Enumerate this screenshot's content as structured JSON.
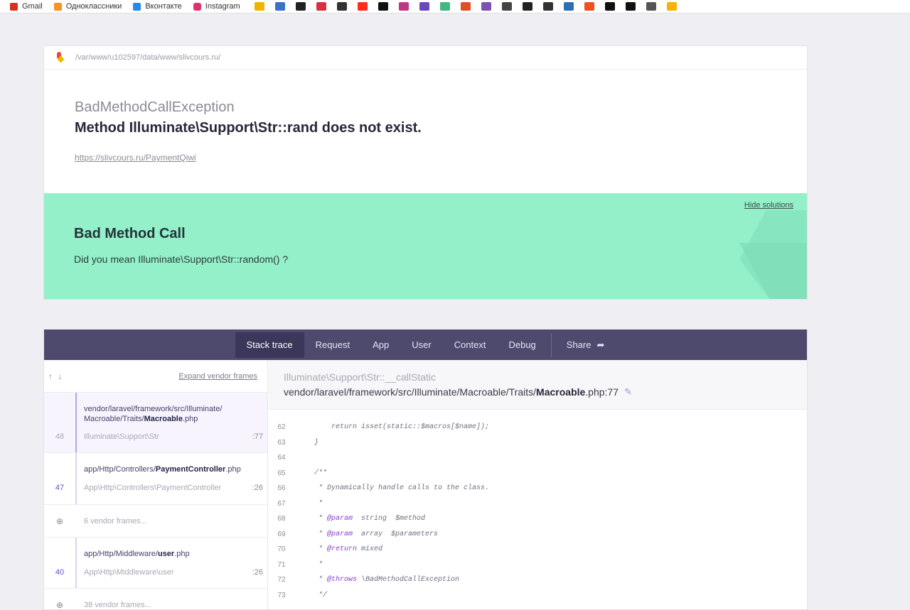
{
  "bookmarks": {
    "items": [
      {
        "label": "Gmail",
        "color": "#d93025"
      },
      {
        "label": "Одноклассники",
        "color": "#f7931e"
      },
      {
        "label": "Вконтакте",
        "color": "#2787f5"
      },
      {
        "label": "Instagram",
        "color": "#e1306c"
      }
    ],
    "icons": [
      {
        "name": "bookmark-pen-icon",
        "color": "#f0b400"
      },
      {
        "name": "bookmark-mdb-icon",
        "color": "#3b71ca"
      },
      {
        "name": "bookmark-doc-icon",
        "color": "#222222"
      },
      {
        "name": "bookmark-pdf-icon",
        "color": "#d9303e"
      },
      {
        "name": "bookmark-box-icon",
        "color": "#333333"
      },
      {
        "name": "bookmark-laravel-icon",
        "color": "#ff2d20"
      },
      {
        "name": "bookmark-dev-icon",
        "color": "#111111"
      },
      {
        "name": "bookmark-github-icon",
        "color": "#c13584"
      },
      {
        "name": "bookmark-bird-icon",
        "color": "#6b46c1"
      },
      {
        "name": "bookmark-vue-icon",
        "color": "#41b883"
      },
      {
        "name": "bookmark-html-icon",
        "color": "#e44d26"
      },
      {
        "name": "bookmark-bootstrap-icon",
        "color": "#7952b3"
      },
      {
        "name": "bookmark-globe-icon",
        "color": "#444444"
      },
      {
        "name": "bookmark-codepen-icon",
        "color": "#222222"
      },
      {
        "name": "bookmark-bc-icon",
        "color": "#333333"
      },
      {
        "name": "bookmark-tool-icon",
        "color": "#2c6fb7"
      },
      {
        "name": "bookmark-figma-icon",
        "color": "#f24e1e"
      },
      {
        "name": "bookmark-bars-icon",
        "color": "#111111"
      },
      {
        "name": "bookmark-k-icon",
        "color": "#111111"
      },
      {
        "name": "bookmark-chat-icon",
        "color": "#555555"
      },
      {
        "name": "bookmark-search-icon",
        "color": "#f4b400"
      }
    ]
  },
  "error": {
    "path": "/var/www/u102597/data/www/slivcours.ru/",
    "exception_class": "BadMethodCallException",
    "message": "Method Illuminate\\Support\\Str::rand does not exist.",
    "url": "https://slivcours.ru/PaymentQiwi"
  },
  "solution": {
    "hide_label": "Hide solutions",
    "title": "Bad Method Call",
    "description": "Did you mean Illuminate\\Support\\Str::random() ?"
  },
  "nav": {
    "tabs": [
      "Stack trace",
      "Request",
      "App",
      "User",
      "Context",
      "Debug"
    ],
    "active": "Stack trace",
    "share_label": "Share"
  },
  "stack": {
    "arrows": "↑ ↓",
    "expand_label": "Expand vendor frames",
    "frames": [
      {
        "number": "48",
        "file_prefix": "vendor/laravel/framework/src/Illuminate/\nMacroable/Traits/",
        "file_name": "Macroable",
        "file_ext": ".php",
        "class": "Illuminate\\Support\\Str",
        "line": ":77"
      },
      {
        "number": "47",
        "file_prefix": "app/Http/Controllers/",
        "file_name": "PaymentController",
        "file_ext": ".php",
        "class": "App\\Http\\Controllers\\PaymentController",
        "line": ":26"
      },
      {
        "vendor": "6 vendor frames..."
      },
      {
        "number": "40",
        "file_prefix": "app/Http/Middleware/",
        "file_name": "user",
        "file_ext": ".php",
        "class": "App\\Http\\Middleware\\user",
        "line": ":26"
      },
      {
        "vendor": "38 vendor frames..."
      }
    ]
  },
  "detail": {
    "method": "Illuminate\\Support\\Str::__callStatic",
    "file_prefix": "vendor/laravel/framework/src/Illuminate/Macroable/Traits/",
    "file_name": "Macroable",
    "file_suffix": ".php:77",
    "code": [
      {
        "n": "62",
        "text": "        return isset(static::$macros[$name]);"
      },
      {
        "n": "63",
        "text": "    }"
      },
      {
        "n": "64",
        "text": ""
      },
      {
        "n": "65",
        "text": "    /**"
      },
      {
        "n": "66",
        "text": "     * Dynamically handle calls to the class."
      },
      {
        "n": "67",
        "text": "     *"
      },
      {
        "n": "68",
        "pre": "     * ",
        "kw": "@param",
        "text": "  string  $method"
      },
      {
        "n": "69",
        "pre": "     * ",
        "kw": "@param",
        "text": "  array  $parameters"
      },
      {
        "n": "70",
        "pre": "     * ",
        "kw": "@return",
        "text": " mixed"
      },
      {
        "n": "71",
        "text": "     *"
      },
      {
        "n": "72",
        "pre": "     * ",
        "kw": "@throws",
        "text": " \\BadMethodCallException"
      },
      {
        "n": "73",
        "text": "     */"
      }
    ]
  }
}
